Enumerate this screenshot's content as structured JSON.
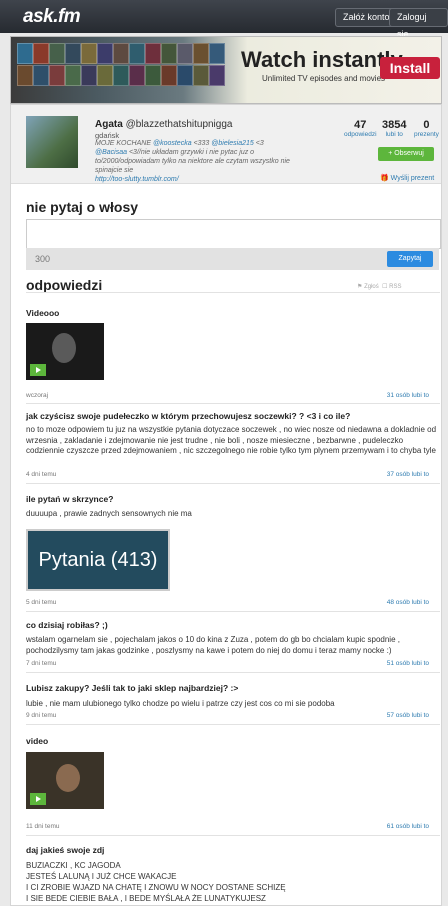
{
  "header": {
    "logo": "ask.fm",
    "create_account": "Załóż konto",
    "login": "Zaloguj się"
  },
  "ad": {
    "title": "Watch instantly.",
    "subtitle": "Unlimited TV episodes and movies",
    "button": "Install"
  },
  "profile": {
    "name": "Agata",
    "username": "@blazzethatshitupnigga",
    "city": "gdańsk",
    "bio_1": "MOJE KOCHANE",
    "bio_link_1": "@koostecka",
    "bio_2": "<333",
    "bio_link_2": "@bielesia215",
    "bio_3": "<3",
    "bio_link_3": "@Bacisaa",
    "bio_4": "<3//nie układam grzywki i nie pytac juz o to/2000/odpowiadam tylko na niektore ale czytam wszystko nie spinajcie sie",
    "bio_url": "http://too-slutty.tumblr.com/",
    "stats": [
      {
        "value": "47",
        "label": "odpowiedzi"
      },
      {
        "value": "3854",
        "label": "lubi to"
      },
      {
        "value": "0",
        "label": "prezenty"
      }
    ],
    "follow": "+ Obserwuj",
    "gift": "Wyślij prezent"
  },
  "question_form": {
    "title": "nie pytaj o włosy",
    "count": "300",
    "submit": "Zapytaj"
  },
  "answers_section": {
    "title": "odpowiedzi",
    "report": "Zgłoś",
    "rss": "RSS"
  },
  "answers": [
    {
      "question": "Videooo",
      "meta": "wczoraj",
      "likes": "31 osób lubi to"
    },
    {
      "question": "jak czyścisz swoje pudełeczko w którym przechowujesz soczewki? ? <3 i co ile?",
      "body": "no to moze odpowiem tu juz na wszystkie pytania dotyczace soczewek , no wiec nosze od niedawna a dokladnie od wrzesnia , zakladanie i zdejmowanie nie jest trudne , nie boli , nosze miesieczne , bezbarwne , pudeleczko codziennie czyszcze przed zdejmowaniem , nic szczegolnego nie robie tylko tym plynem przemywam i to chyba tyle",
      "meta": "4 dni temu",
      "likes": "37 osób lubi to"
    },
    {
      "question": "ile pytań w skrzynce?",
      "body": "duuuupa , prawie zadnych sensownych nie ma",
      "image_text": "Pytania (413)",
      "meta": "5 dni temu",
      "likes": "48 osób lubi to"
    },
    {
      "question": "co dzisiaj robiłas? ;)",
      "body": "wstalam ogarnelam sie , pojechalam jakos o 10 do kina z Zuza , potem do gb bo chcialam kupic spodnie , pochodzilysmy tam jakas godzinke , poszlysmy na kawe i potem do niej do domu i teraz mamy nocke :)",
      "meta": "7 dni temu",
      "likes": "51 osób lubi to"
    },
    {
      "question": "Lubisz zakupy? Jeśli tak to jaki sklep najbardziej? :>",
      "body": "lubie , nie mam ulubionego tylko chodze po wielu i patrze czy jest cos co mi sie podoba",
      "meta": "9 dni temu",
      "likes": "57 osób lubi to"
    },
    {
      "question": "video",
      "meta": "11 dni temu",
      "likes": "61 osób lubi to"
    },
    {
      "question": "daj jakieś swoje zdj",
      "body": "BUZIACZKI , KC JAGODA\nJESTEŚ LALUNĄ I JUŻ CHCE WAKACJE\nI CI ZROBIE WJAZD NA CHATĘ I ZNOWU W NOCY DOSTANE SCHIZĘ\nI SIE BEDE CIEBIE BAŁA , I BEDE MYŚLAŁA ŻE LUNATYKUJESZ"
    }
  ]
}
